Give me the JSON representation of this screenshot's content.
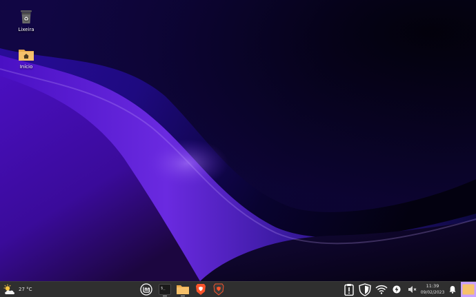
{
  "desktop": {
    "icons": [
      {
        "label": "Lixeira",
        "icon": "trash-icon"
      },
      {
        "label": "Início",
        "icon": "home-folder-icon"
      }
    ]
  },
  "taskbar": {
    "weather": {
      "temperature": "27 °C",
      "icon": "partly-cloudy-icon"
    },
    "launchers": [
      {
        "name": "Menu",
        "icon": "linux-mint-menu-icon"
      },
      {
        "name": "Terminal",
        "icon": "terminal-icon"
      },
      {
        "name": "Files",
        "icon": "folder-icon"
      },
      {
        "name": "Brave",
        "icon": "brave-browser-icon"
      },
      {
        "name": "Brave Private",
        "icon": "brave-private-icon"
      }
    ],
    "tray": [
      {
        "name": "clipboard",
        "icon": "clipboard-icon"
      },
      {
        "name": "shield",
        "icon": "shield-icon"
      },
      {
        "name": "wifi",
        "icon": "wifi-icon"
      },
      {
        "name": "update",
        "icon": "update-icon"
      },
      {
        "name": "volume",
        "icon": "volume-muted-icon"
      },
      {
        "name": "notifications",
        "icon": "bell-icon"
      }
    ],
    "clock": {
      "time": "11:39",
      "date": "09/02/2023"
    }
  },
  "colors": {
    "wallpaper_dark": "#07021c",
    "wallpaper_purple": "#5a16d8",
    "taskbar_bg": "#2f2f2f",
    "accent": "#c8a0ff"
  }
}
